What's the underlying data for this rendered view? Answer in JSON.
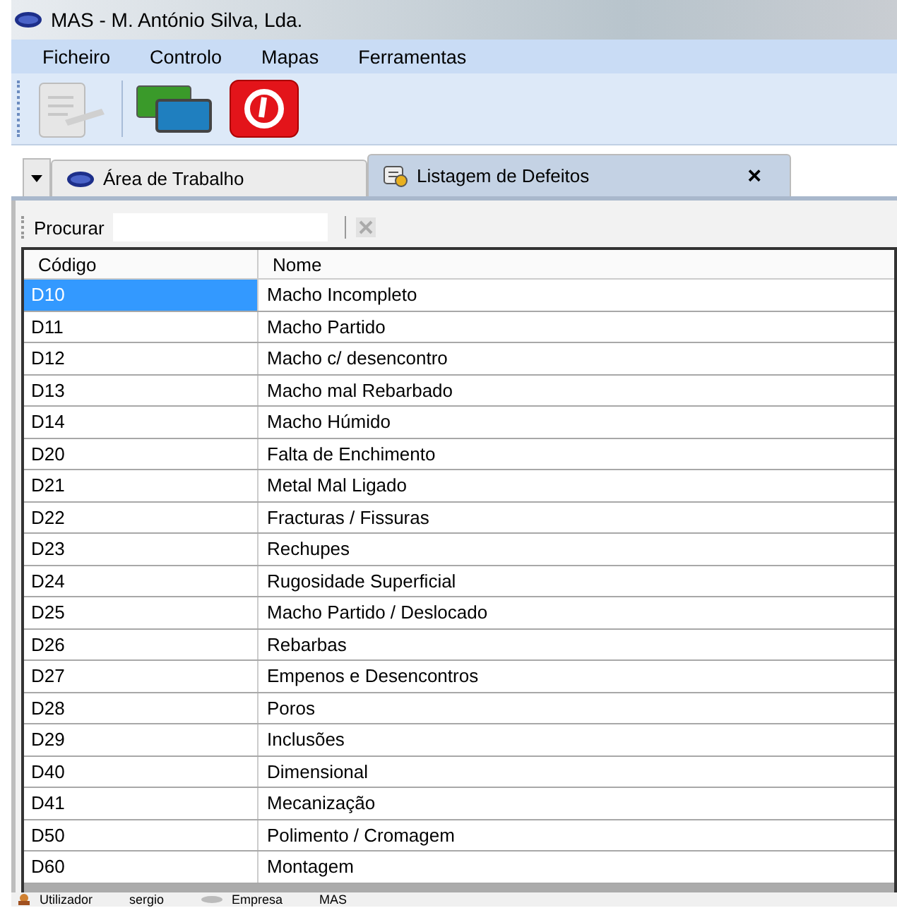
{
  "window": {
    "title": "MAS - M. António Silva, Lda."
  },
  "menu": [
    "Ficheiro",
    "Controlo",
    "Mapas",
    "Ferramentas"
  ],
  "tabs": [
    {
      "label": "Área de Trabalho",
      "selected": false,
      "closable": false
    },
    {
      "label": "Listagem de Defeitos",
      "selected": true,
      "closable": true
    }
  ],
  "tab_close": "×",
  "search": {
    "label": "Procurar"
  },
  "table": {
    "columns": [
      "Código",
      "Nome"
    ],
    "rows": [
      {
        "code": "D10",
        "name": "Macho Incompleto",
        "selected": true
      },
      {
        "code": "D11",
        "name": "Macho Partido",
        "selected": false
      },
      {
        "code": "D12",
        "name": "Macho c/ desencontro",
        "selected": false
      },
      {
        "code": "D13",
        "name": "Macho mal Rebarbado",
        "selected": false
      },
      {
        "code": "D14",
        "name": "Macho Húmido",
        "selected": false
      },
      {
        "code": "D20",
        "name": "Falta de Enchimento",
        "selected": false
      },
      {
        "code": "D21",
        "name": "Metal Mal Ligado",
        "selected": false
      },
      {
        "code": "D22",
        "name": "Fracturas / Fissuras",
        "selected": false
      },
      {
        "code": "D23",
        "name": "Rechupes",
        "selected": false
      },
      {
        "code": "D24",
        "name": "Rugosidade Superficial",
        "selected": false
      },
      {
        "code": "D25",
        "name": "Macho Partido / Deslocado",
        "selected": false
      },
      {
        "code": "D26",
        "name": "Rebarbas",
        "selected": false
      },
      {
        "code": "D27",
        "name": "Empenos e Desencontros",
        "selected": false
      },
      {
        "code": "D28",
        "name": "Poros",
        "selected": false
      },
      {
        "code": "D29",
        "name": "Inclusões",
        "selected": false
      },
      {
        "code": "D40",
        "name": "Dimensional",
        "selected": false
      },
      {
        "code": "D41",
        "name": "Mecanização",
        "selected": false
      },
      {
        "code": "D50",
        "name": "Polimento / Cromagem",
        "selected": false
      },
      {
        "code": "D60",
        "name": "Montagem",
        "selected": false
      }
    ]
  },
  "status_bar": {
    "user_label": "Utilizador",
    "user": "sergio",
    "company_label": "Empresa",
    "company": "MAS"
  }
}
